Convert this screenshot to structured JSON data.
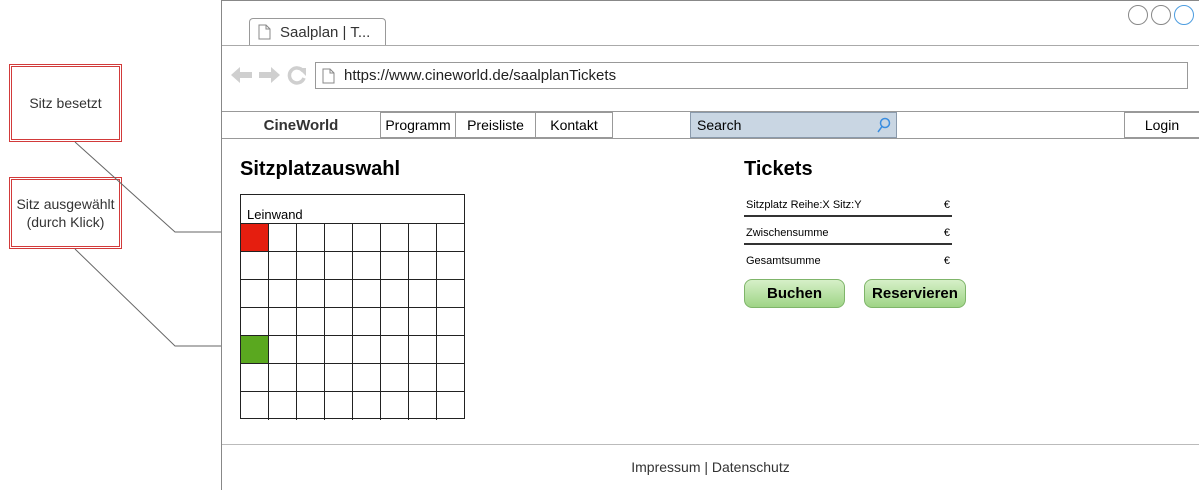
{
  "annotations": {
    "occupied": "Sitz besetzt",
    "selected": "Sitz ausgewählt (durch Klick)"
  },
  "browser": {
    "tab_title": "Saalplan | T...",
    "url": "https://www.cineworld.de/saalplanTickets"
  },
  "nav": {
    "brand": "CineWorld",
    "items": [
      "Programm",
      "Preisliste",
      "Kontakt"
    ],
    "search_placeholder": "Search",
    "login": "Login"
  },
  "seating": {
    "title": "Sitzplatzauswahl",
    "screen_label": "Leinwand",
    "rows": 7,
    "cols": 8,
    "seats": [
      {
        "row": 1,
        "col": 1,
        "state": "besetzt"
      },
      {
        "row": 5,
        "col": 1,
        "state": "ausgewählt"
      }
    ],
    "colors": {
      "occupied": "#e51e0f",
      "selected": "#5aa81f"
    }
  },
  "tickets": {
    "title": "Tickets",
    "lines": [
      {
        "label": "Sitzplatz Reihe:X Sitz:Y",
        "value": "€"
      },
      {
        "label": "Zwischensumme",
        "value": "€"
      },
      {
        "label": "Gesamtsumme",
        "value": "€"
      }
    ],
    "book_label": "Buchen",
    "reserve_label": "Reservieren"
  },
  "footer": {
    "text": "Impressum | Datenschutz"
  }
}
